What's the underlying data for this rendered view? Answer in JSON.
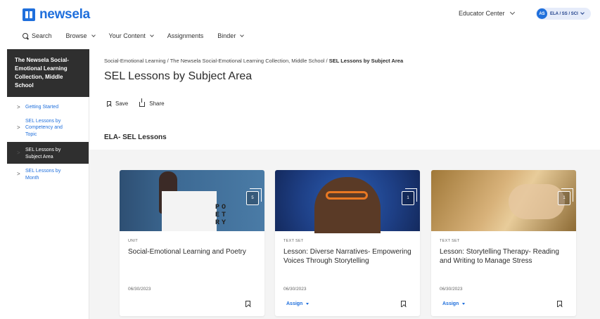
{
  "header": {
    "logo_text": "newsela",
    "educator_center": "Educator Center",
    "user_initials": "AS",
    "user_label": "ELA / SS / SCI",
    "brand_color": "#1f6fdc"
  },
  "nav": {
    "search": "Search",
    "browse": "Browse",
    "your_content": "Your Content",
    "assignments": "Assignments",
    "binder": "Binder"
  },
  "sidebar": {
    "header": "The Newsela Social-Emotional Learning Collection, Middle School",
    "items": [
      {
        "label": "Getting Started",
        "active": false
      },
      {
        "label": "SEL Lessons by Competency and Topic",
        "active": false
      },
      {
        "label": "SEL Lessons by Subject Area",
        "active": true
      },
      {
        "label": "SEL Lessons by Month",
        "active": false
      }
    ]
  },
  "breadcrumb": {
    "crumb1": "Social-Emotional Learning",
    "sep": "/",
    "crumb2": "The Newsela Social-Emotional Learning Collection, Middle School",
    "current": "SEL Lessons by Subject Area"
  },
  "page": {
    "title": "SEL Lessons by Subject Area",
    "save": "Save",
    "share": "Share",
    "section_title": "ELA- SEL Lessons"
  },
  "cards": [
    {
      "type": "UNIT",
      "title": "Social-Emotional Learning and Poetry",
      "date": "06/30/2023",
      "count": "5",
      "assign": "",
      "thumb_text": "PO ET RY"
    },
    {
      "type": "TEXT SET",
      "title": "Lesson: Diverse Narratives- Empowering Voices Through Storytelling",
      "date": "06/30/2023",
      "count": "1",
      "assign": "Assign"
    },
    {
      "type": "TEXT SET",
      "title": "Lesson: Storytelling Therapy- Reading and Writing to Manage Stress",
      "date": "06/30/2023",
      "count": "1",
      "assign": "Assign"
    }
  ]
}
